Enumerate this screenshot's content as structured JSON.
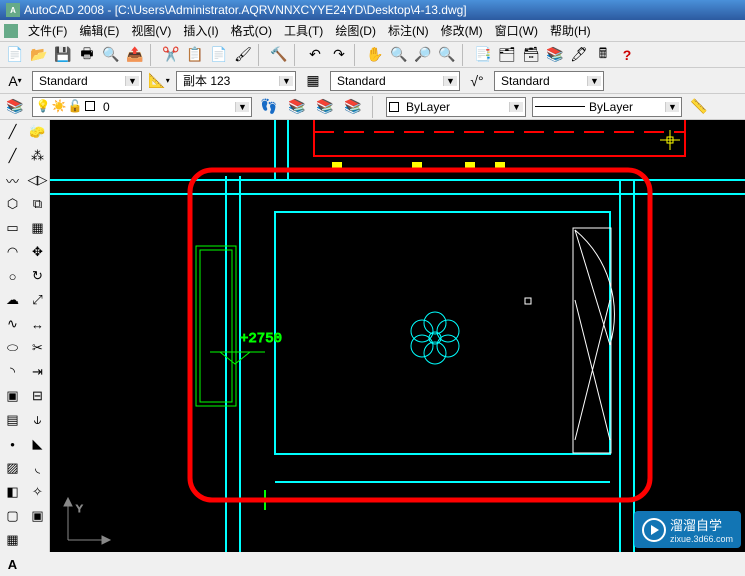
{
  "title": "AutoCAD 2008 - [C:\\Users\\Administrator.AQRVNNXCYYE24YD\\Desktop\\4-13.dwg]",
  "menu": [
    {
      "label": "文件(F)"
    },
    {
      "label": "编辑(E)"
    },
    {
      "label": "视图(V)"
    },
    {
      "label": "插入(I)"
    },
    {
      "label": "格式(O)"
    },
    {
      "label": "工具(T)"
    },
    {
      "label": "绘图(D)"
    },
    {
      "label": "标注(N)"
    },
    {
      "label": "修改(M)"
    },
    {
      "label": "窗口(W)"
    },
    {
      "label": "帮助(H)"
    }
  ],
  "styles": {
    "text_style": "Standard",
    "dim_style": "副本 123",
    "table_style": "Standard",
    "mleader_style": "Standard"
  },
  "layers": {
    "current": "0",
    "color": "ByLayer",
    "lineweight": "ByLayer"
  },
  "canvas": {
    "elevation_text": "+2750"
  },
  "watermark": {
    "name": "溜溜自学",
    "sub": "zixue.3d66.com"
  }
}
